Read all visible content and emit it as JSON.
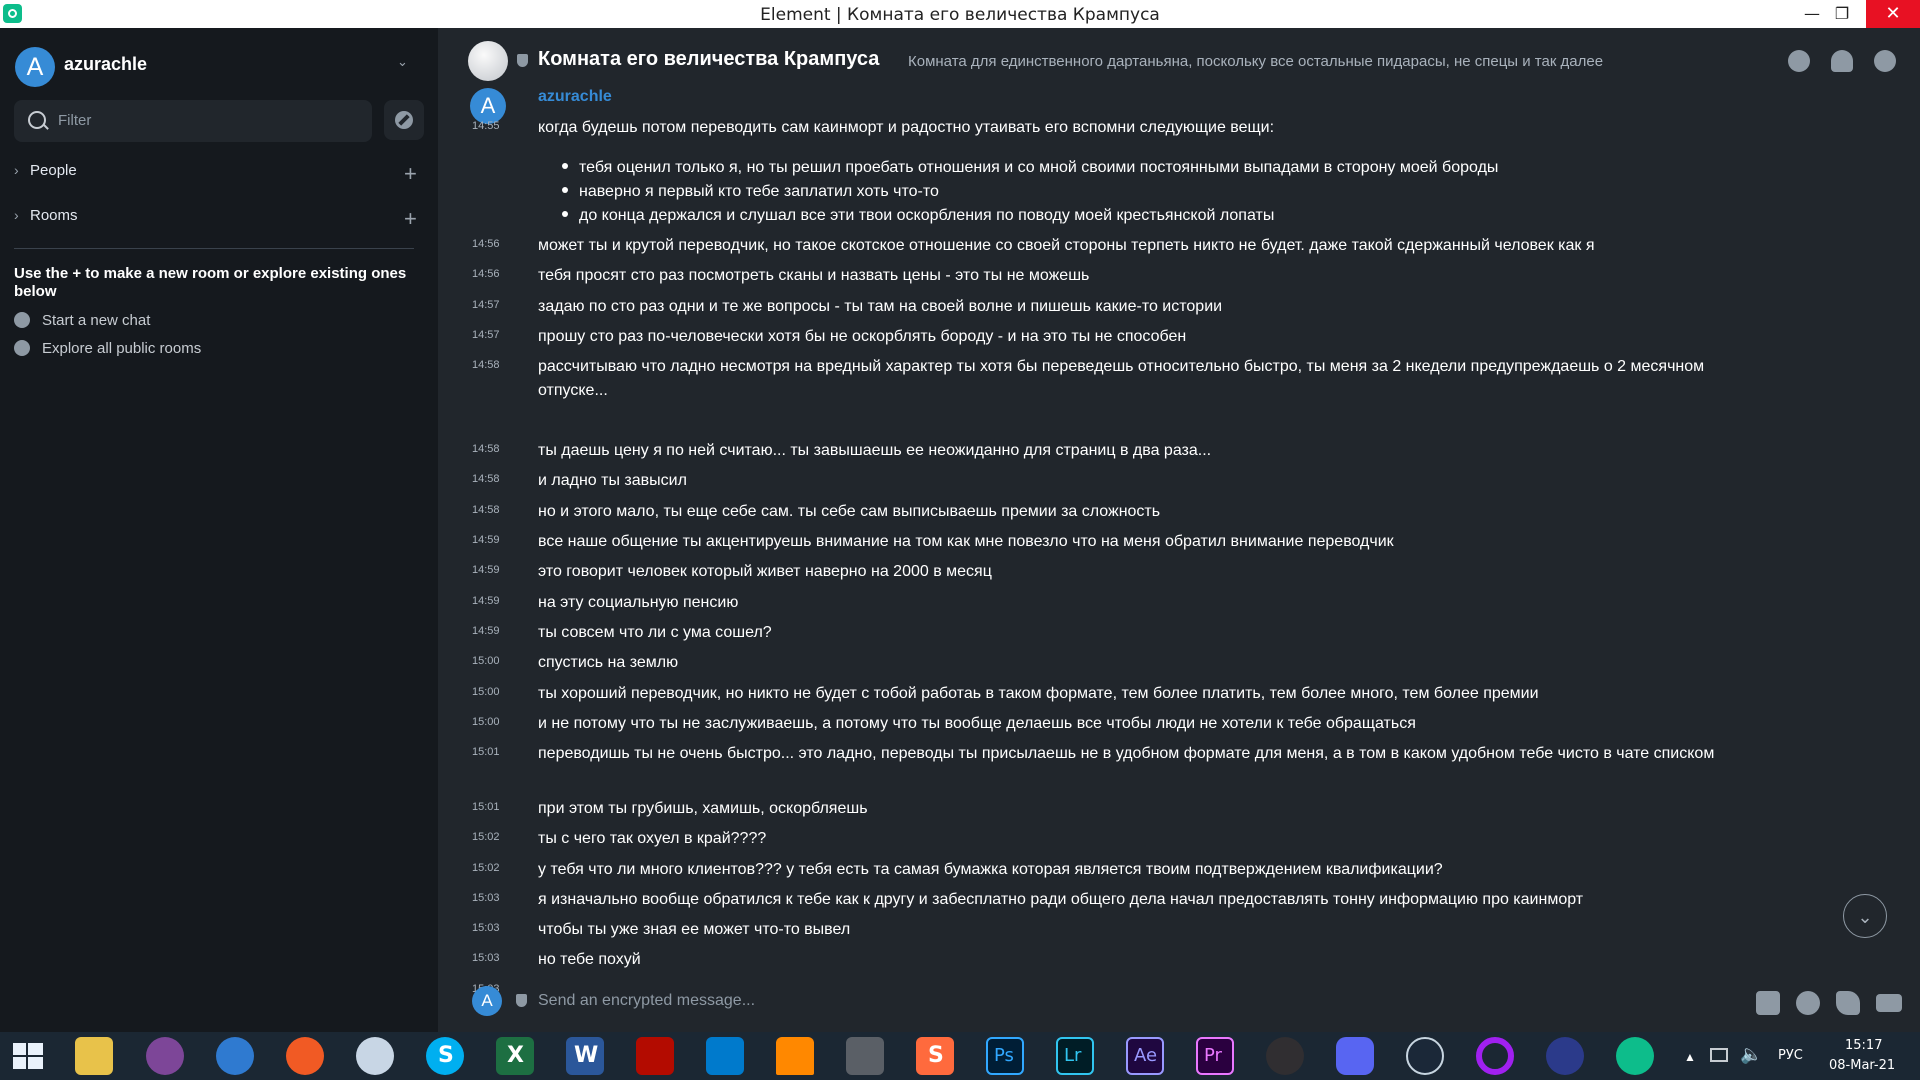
{
  "window": {
    "title": "Element | Комната его величества Крампуса",
    "minimize": "—",
    "maximize": "❐",
    "close": "✕"
  },
  "sidebar": {
    "account_initial": "A",
    "account_name": "azurachle",
    "filter_placeholder": "Filter",
    "sections": [
      {
        "label": "People"
      },
      {
        "label": "Rooms"
      }
    ],
    "hint": "Use the + to make a new room or explore existing ones below",
    "actions": [
      {
        "label": "Start a new chat"
      },
      {
        "label": "Explore all public rooms"
      }
    ]
  },
  "room": {
    "name": "Комната его величества Крампуса",
    "topic": "Комната для единственного дартаньяна, поскольку все остальные пидарасы, не спецы и так далее"
  },
  "timeline": {
    "sender_initial": "A",
    "sender": "azurachle",
    "messages": [
      {
        "time": "14:55",
        "text": "когда будешь потом переводить сам каинморт и радостно утаивать его вспомни следующие вещи:"
      },
      {
        "time": "14:56",
        "text": "может ты и крутой переводчик, но такое скотское отношение со своей стороны терпеть никто не будет. даже такой сдержанный человек как я"
      },
      {
        "time": "14:56",
        "text": "тебя просят сто раз посмотреть сканы и назвать цены - это ты не можешь"
      },
      {
        "time": "14:57",
        "text": "задаю по сто раз одни и те же вопросы - ты там на своей волне и пишешь какие-то истории"
      },
      {
        "time": "14:57",
        "text": "прошу сто раз по-человечески хотя бы не оскорблять бороду - и на это ты не способен"
      },
      {
        "time": "14:58",
        "text": "рассчитываю что ладно несмотря на вредный характер ты хотя бы переведешь относительно быстро, ты меня за 2 нкедели предупреждаешь о 2 месячном отпуске..."
      },
      {
        "time": "14:58",
        "text": "ты даешь цену я по ней считаю... ты завышаешь ее неожиданно для страниц в два раза..."
      },
      {
        "time": "14:58",
        "text": "и ладно ты завысил"
      },
      {
        "time": "14:58",
        "text": "но и этого мало, ты еще себе сам. ты себе сам выписываешь премии за сложность"
      },
      {
        "time": "14:59",
        "text": "все наше общение ты акцентируешь внимание на том как мне повезло что на меня обратил внимание переводчик"
      },
      {
        "time": "14:59",
        "text": "это говорит человек который живет наверно на 2000 в месяц"
      },
      {
        "time": "14:59",
        "text": "на эту социальную пенсию"
      },
      {
        "time": "14:59",
        "text": "ты совсем что ли с ума сошел?"
      },
      {
        "time": "15:00",
        "text": "спустись на землю"
      },
      {
        "time": "15:00",
        "text": "ты хороший переводчик, но никто не будет с тобой работаь в таком формате, тем более платить, тем более много, тем более премии"
      },
      {
        "time": "15:00",
        "text": "и не потому что ты не заслуживаешь, а потому что ты вообще делаешь все чтобы люди не хотели к тебе обращаться"
      },
      {
        "time": "15:01",
        "text": "переводишь ты не очень быстро... это ладно, переводы ты присылаешь не в удобном формате для меня, а в том в каком удобном тебе чисто в чате списком"
      },
      {
        "time": "15:01",
        "text": "при этом ты грубишь, хамишь, оскорбляешь"
      },
      {
        "time": "15:02",
        "text": "ты с чего так охуел в край????"
      },
      {
        "time": "15:02",
        "text": "у тебя что ли много клиентов??? у тебя есть та самая бумажка которая является твоим подтверждением квалификации?"
      },
      {
        "time": "15:03",
        "text": "я изначально вообще обратился к тебе как к другу и забесплатно ради общего дела начал предоставлять тонну информацию про каинморт"
      },
      {
        "time": "15:03",
        "text": "чтобы ты уже зная ее может что-то вывел"
      },
      {
        "time": "15:03",
        "text": "но тебе похуй"
      },
      {
        "time": "15:03",
        "text": ""
      }
    ],
    "bullets": [
      "тебя оценил только я, но ты решил проебать отношения и со мной своими постоянными выпадами в сторону моей бороды",
      "наверно я первый кто тебе заплатил хоть что-то",
      "до конца держался и слушал все эти твои оскорбления по поводу моей крестьянской лопаты"
    ]
  },
  "composer": {
    "initial": "A",
    "placeholder": "Send an encrypted message..."
  },
  "taskbar": {
    "apps": [
      "Windows",
      "Explorer",
      "Tor",
      "Browser",
      "Firefox",
      "Bubble",
      "Skype",
      "Excel",
      "Word",
      "Acrobat",
      "VS Code",
      "VLC",
      "Downloader",
      "Sublime",
      "Photoshop",
      "Lightroom",
      "After Effects",
      "Premiere",
      "OBS",
      "Discord",
      "Steam",
      "Opera",
      "VPN",
      "Element"
    ],
    "app_glyphs": {
      "ps": "Ps",
      "lr": "Lr",
      "ae": "Ae",
      "pr": "Pr",
      "x": "X",
      "w": "W",
      "s": "S"
    },
    "lang": "РУС",
    "time": "15:17",
    "date": "08-Mar-21"
  },
  "colors": {
    "accent": "#0dbd8b",
    "link": "#368bd6",
    "background": "#21262c",
    "sidebar": "#15191e"
  }
}
